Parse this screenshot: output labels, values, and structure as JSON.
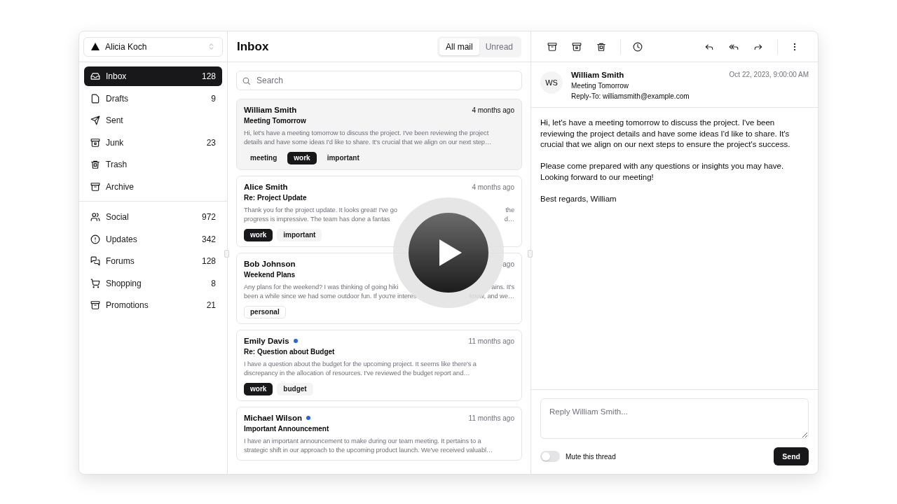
{
  "account": {
    "name": "Alicia Koch"
  },
  "nav_primary": [
    {
      "label": "Inbox",
      "count": "128",
      "selected": true
    },
    {
      "label": "Drafts",
      "count": "9",
      "selected": false
    },
    {
      "label": "Sent",
      "selected": false
    },
    {
      "label": "Junk",
      "count": "23",
      "selected": false
    },
    {
      "label": "Trash",
      "selected": false
    },
    {
      "label": "Archive",
      "selected": false
    }
  ],
  "nav_secondary": [
    {
      "label": "Social",
      "count": "972",
      "selected": false
    },
    {
      "label": "Updates",
      "count": "342",
      "selected": false
    },
    {
      "label": "Forums",
      "count": "128",
      "selected": false
    },
    {
      "label": "Shopping",
      "count": "8",
      "selected": false
    },
    {
      "label": "Promotions",
      "count": "21",
      "selected": false
    }
  ],
  "list": {
    "title": "Inbox",
    "filters": [
      {
        "label": "All mail",
        "selected": true
      },
      {
        "label": "Unread",
        "selected": false
      }
    ],
    "search": {
      "placeholder": "Search"
    },
    "emails": [
      {
        "sender": "William Smith",
        "unread": false,
        "selected": true,
        "date": "4 months ago",
        "subject": "Meeting Tomorrow",
        "preview": [
          [
            "Hi, let's have a meeting tomorrow to discuss the project. I've been reviewing the project"
          ],
          [
            "details and have some ideas I'd like to share. It's crucial that we align on our next step…"
          ]
        ],
        "tags": [
          {
            "label": "meeting",
            "kind": "secondary"
          },
          {
            "label": "work",
            "kind": "primary"
          },
          {
            "label": "important",
            "kind": "secondary"
          }
        ]
      },
      {
        "sender": "Alice Smith",
        "unread": false,
        "selected": false,
        "date": "4 months ago",
        "subject": "Re: Project Update",
        "preview": [
          [
            "Thank you for the project update. It looks great! I've go",
            "the"
          ],
          [
            "progress is impressive. The team has done a fantas",
            "d…"
          ]
        ],
        "tags": [
          {
            "label": "work",
            "kind": "primary"
          },
          {
            "label": "important",
            "kind": "secondary"
          }
        ]
      },
      {
        "sender": "Bob Johnson",
        "unread": false,
        "selected": false,
        "date": "ago",
        "subject": "Weekend Plans",
        "preview": [
          [
            "Any plans for the weekend? I was thinking of going hiki",
            "ains. It's"
          ],
          [
            "been a while since we had some outdoor fun. If you're interes",
            "know, and we…"
          ]
        ],
        "tags": [
          {
            "label": "personal",
            "kind": "outline"
          }
        ]
      },
      {
        "sender": "Emily Davis",
        "unread": true,
        "selected": false,
        "date": "11 months ago",
        "subject": "Re: Question about Budget",
        "preview": [
          [
            "I have a question about the budget for the upcoming project. It seems like there's a"
          ],
          [
            "discrepancy in the allocation of resources. I've reviewed the budget report and…"
          ]
        ],
        "tags": [
          {
            "label": "work",
            "kind": "primary"
          },
          {
            "label": "budget",
            "kind": "secondary"
          }
        ]
      },
      {
        "sender": "Michael Wilson",
        "unread": true,
        "selected": false,
        "date": "11 months ago",
        "subject": "Important Announcement",
        "preview": [
          [
            "I have an important announcement to make during our team meeting. It pertains to a"
          ],
          [
            "strategic shift in our approach to the upcoming product launch. We've received valuabl…"
          ]
        ]
      }
    ]
  },
  "detail": {
    "initials": "WS",
    "sender": "William Smith",
    "subject": "Meeting Tomorrow",
    "reply_to": "Reply-To: williamsmith@example.com",
    "date": "Oct 22, 2023, 9:00:00 AM",
    "body": [
      "Hi, let's have a meeting tomorrow to discuss the project. I've been reviewing the project details and have some ideas I'd like to share. It's crucial that we align on our next steps to ensure the project's success.",
      "Please come prepared with any questions or insights you may have. Looking forward to our meeting!",
      "Best regards, William"
    ],
    "reply": {
      "placeholder": "Reply William Smith...",
      "mute": {
        "label": "Mute this thread",
        "on": false
      },
      "send": "Send"
    }
  }
}
